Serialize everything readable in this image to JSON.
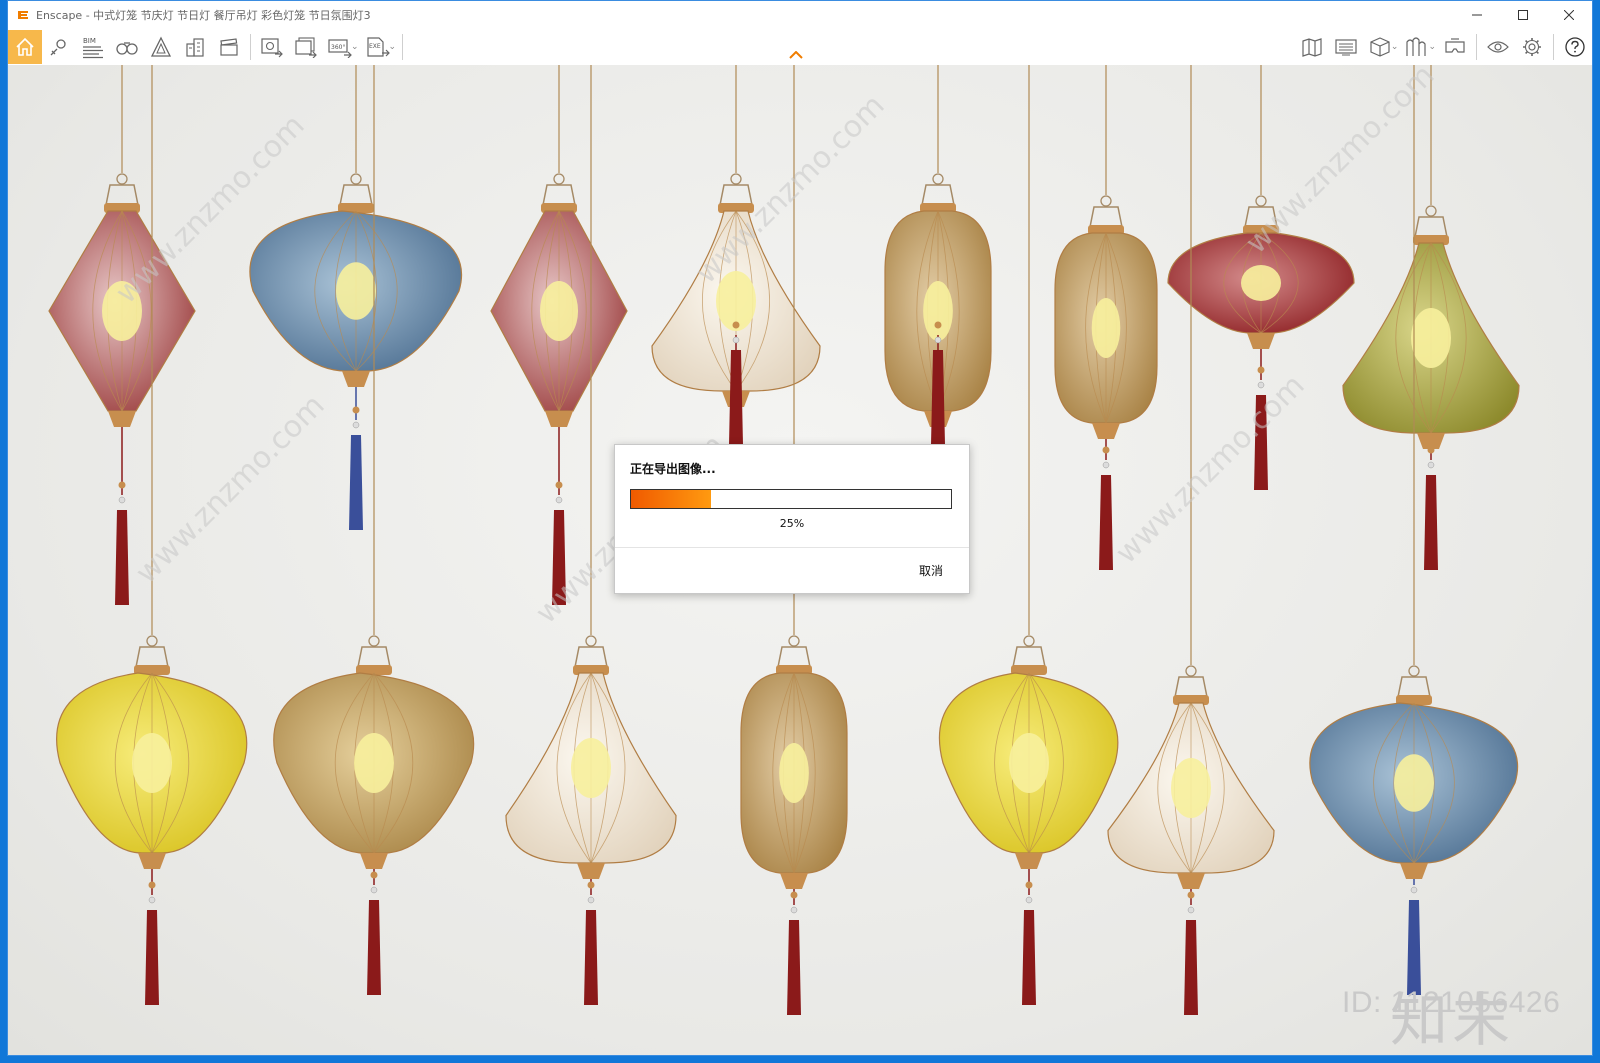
{
  "window": {
    "title": "Enscape - 中式灯笼 节庆灯 节日灯 餐厅吊灯 彩色灯笼 节日氛围灯3"
  },
  "toolbar": {
    "bim_label": "BIM",
    "pano_label": "360°",
    "exe_label": "EXE"
  },
  "dialog": {
    "title": "正在导出图像...",
    "progress": 0.25,
    "percent_text": "25%",
    "cancel_label": "取消"
  },
  "watermark": {
    "logo_text": "知末",
    "id_text": "ID: 1121056426",
    "diagonal_text": "www.znzmo.com"
  },
  "colors": {
    "accent": "#f7b84b",
    "progress_start": "#f05a00",
    "progress_end": "#ff9a10",
    "desktop": "#1177d8"
  }
}
